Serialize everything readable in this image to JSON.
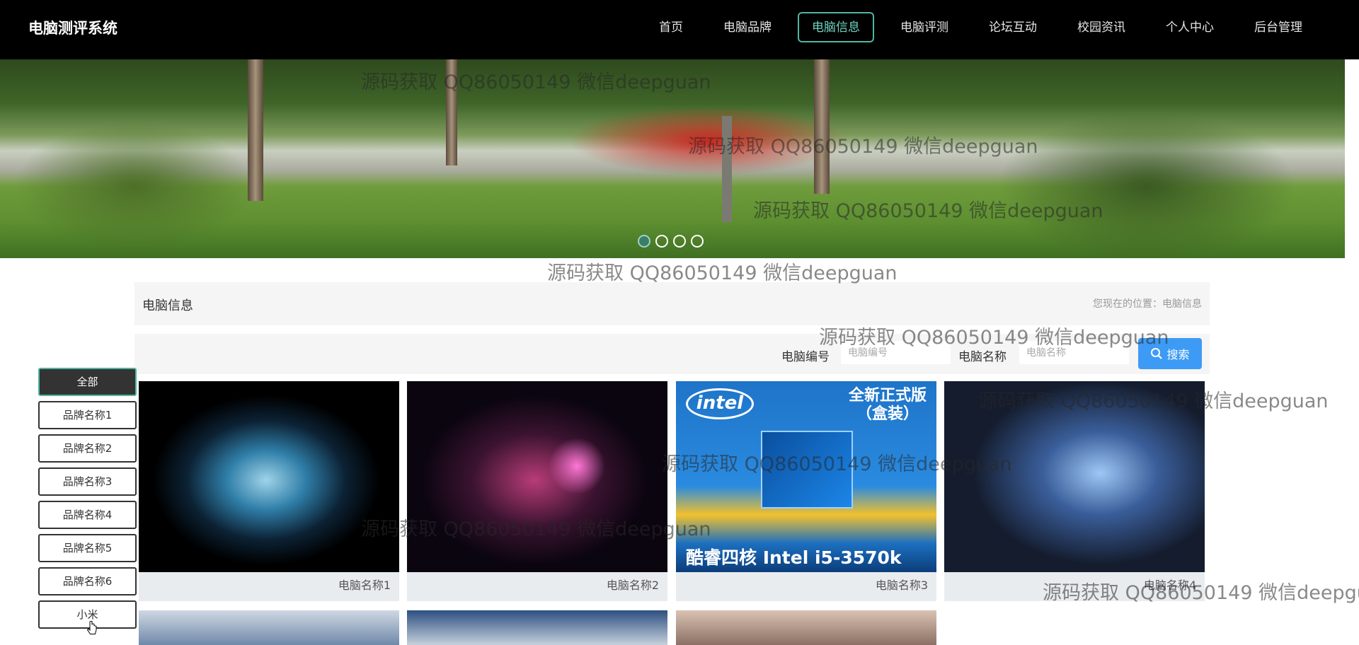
{
  "header": {
    "brand": "电脑测评系统",
    "nav": [
      {
        "label": "首页",
        "active": false
      },
      {
        "label": "电脑品牌",
        "active": false
      },
      {
        "label": "电脑信息",
        "active": true
      },
      {
        "label": "电脑评测",
        "active": false
      },
      {
        "label": "论坛互动",
        "active": false
      },
      {
        "label": "校园资讯",
        "active": false
      },
      {
        "label": "个人中心",
        "active": false
      },
      {
        "label": "后台管理",
        "active": false
      }
    ]
  },
  "banner": {
    "slide_count": 4,
    "active_slide": 1
  },
  "watermark": "源码获取 QQ86050149 微信deepguan",
  "page": {
    "title": "电脑信息",
    "breadcrumb": "您现在的位置：电脑信息"
  },
  "search": {
    "id_label": "电脑编号",
    "id_placeholder": "电脑编号",
    "name_label": "电脑名称",
    "name_placeholder": "电脑名称",
    "button_label": "搜索",
    "button_icon": "search-icon"
  },
  "categories": [
    {
      "label": "全部",
      "active": true
    },
    {
      "label": "品牌名称1",
      "active": false
    },
    {
      "label": "品牌名称2",
      "active": false
    },
    {
      "label": "品牌名称3",
      "active": false
    },
    {
      "label": "品牌名称4",
      "active": false
    },
    {
      "label": "品牌名称5",
      "active": false
    },
    {
      "label": "品牌名称6",
      "active": false
    },
    {
      "label": "小米",
      "active": false
    }
  ],
  "products": [
    {
      "name": "电脑名称1"
    },
    {
      "name": "电脑名称2"
    },
    {
      "name": "电脑名称3",
      "image_text": {
        "logo": "intel",
        "top": "全新正式版\n（盒装）",
        "bottom": "酷睿四核 Intel i5-3570k"
      }
    },
    {
      "name": "电脑名称4"
    }
  ],
  "colors": {
    "nav_active_border": "#4fb5a4",
    "search_button": "#3d9bf5",
    "topbar": "#000000"
  }
}
